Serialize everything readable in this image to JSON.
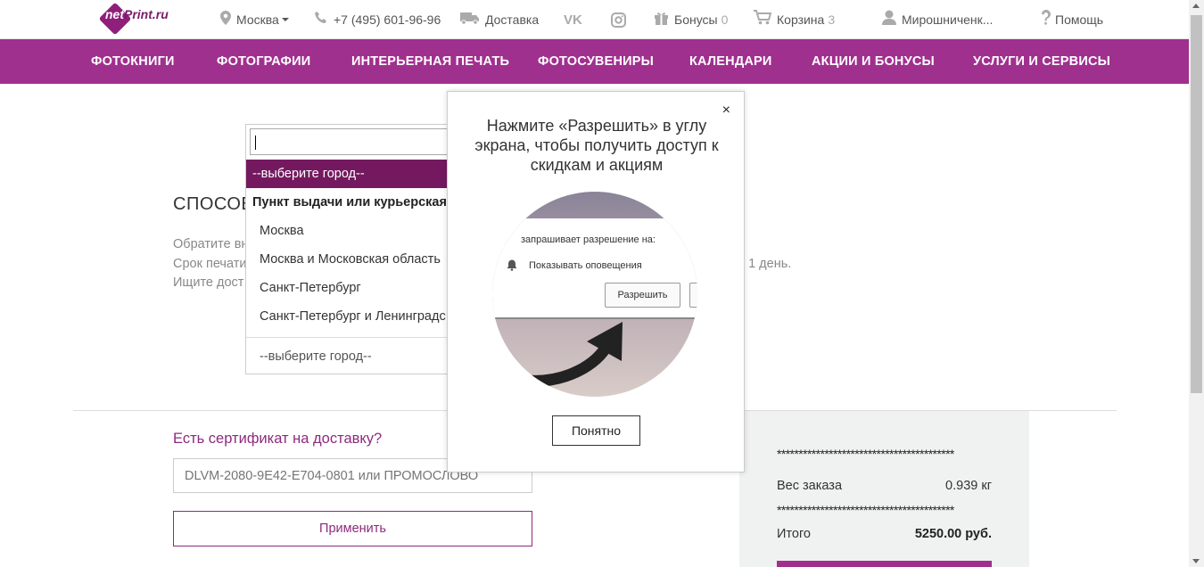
{
  "topbar": {
    "logo_prefix": "net",
    "logo_rest": "Print.ru",
    "city": "Москва",
    "phone": "+7 (495) 601-96-96",
    "delivery": "Доставка",
    "vk": "VK",
    "bonuses_label": "Бонусы",
    "bonuses_count": "0",
    "cart_label": "Корзина",
    "cart_count": "3",
    "user": "Мирошниченк...",
    "help": "Помощь"
  },
  "nav": {
    "items": [
      "ФОТОКНИГИ",
      "ФОТОГРАФИИ",
      "ИНТЕРЬЕРНАЯ ПЕЧАТЬ",
      "ФОТОСУВЕНИРЫ",
      "КАЛЕНДАРИ",
      "АКЦИИ И БОНУСЫ",
      "УСЛУГИ И СЕРВИСЫ"
    ]
  },
  "dropdown": {
    "search_value": "",
    "selected": "--выберите город--",
    "group": "Пункт выдачи или курьерская",
    "options": [
      "Москва",
      "Москва и Московская область",
      "Санкт-Петербург",
      "Санкт-Петербург и Ленинградс"
    ],
    "current": "--выберите город--"
  },
  "page": {
    "heading": "СПОСОБ",
    "note1": "Обратите вн",
    "note2": "Срок печати",
    "note2_tail": "а 1 день.",
    "note3": "Ищите дост"
  },
  "popup": {
    "message": "Нажмите «Разрешить» в углу экрана, чтобы получить доступ к скидкам и акциям",
    "close": "×",
    "browser_request": "запрашивает разрешение на:",
    "browser_notify": "Показывать оповещения",
    "browser_allow": "Разрешить",
    "ok": "Понятно"
  },
  "certificate": {
    "title": "Есть сертификат на доставку?",
    "placeholder": "DLVM-2080-9E42-E704-0801 или ПРОМОСЛОВО",
    "apply": "Применить"
  },
  "summary": {
    "stars": "*****************************************",
    "weight_label": "Вес заказа",
    "weight_value": "0.939 кг",
    "total_label": "Итого",
    "total_value": "5250.00 руб."
  }
}
